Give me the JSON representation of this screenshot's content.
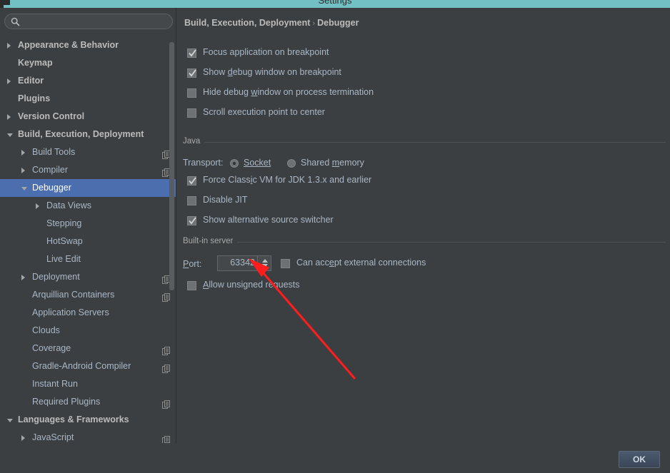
{
  "window": {
    "title": "Settings",
    "titlebar_color": "#72c0c4"
  },
  "sidebar": {
    "search": {
      "value": "",
      "placeholder": "",
      "icon": "search-icon"
    },
    "items": [
      {
        "label": "Appearance & Behavior",
        "indent": 0,
        "arrow": "closed",
        "bold": true,
        "scope_icon": false,
        "selected": false
      },
      {
        "label": "Keymap",
        "indent": 0,
        "arrow": "none",
        "bold": true,
        "scope_icon": false,
        "selected": false
      },
      {
        "label": "Editor",
        "indent": 0,
        "arrow": "closed",
        "bold": true,
        "scope_icon": false,
        "selected": false
      },
      {
        "label": "Plugins",
        "indent": 0,
        "arrow": "none",
        "bold": true,
        "scope_icon": false,
        "selected": false
      },
      {
        "label": "Version Control",
        "indent": 0,
        "arrow": "closed",
        "bold": true,
        "scope_icon": false,
        "selected": false
      },
      {
        "label": "Build, Execution, Deployment",
        "indent": 0,
        "arrow": "open",
        "bold": true,
        "scope_icon": false,
        "selected": false
      },
      {
        "label": "Build Tools",
        "indent": 1,
        "arrow": "closed",
        "bold": false,
        "scope_icon": true,
        "selected": false
      },
      {
        "label": "Compiler",
        "indent": 1,
        "arrow": "closed",
        "bold": false,
        "scope_icon": true,
        "selected": false
      },
      {
        "label": "Debugger",
        "indent": 1,
        "arrow": "open",
        "bold": false,
        "scope_icon": false,
        "selected": true
      },
      {
        "label": "Data Views",
        "indent": 2,
        "arrow": "closed",
        "bold": false,
        "scope_icon": false,
        "selected": false
      },
      {
        "label": "Stepping",
        "indent": 2,
        "arrow": "none",
        "bold": false,
        "scope_icon": false,
        "selected": false
      },
      {
        "label": "HotSwap",
        "indent": 2,
        "arrow": "none",
        "bold": false,
        "scope_icon": false,
        "selected": false
      },
      {
        "label": "Live Edit",
        "indent": 2,
        "arrow": "none",
        "bold": false,
        "scope_icon": false,
        "selected": false
      },
      {
        "label": "Deployment",
        "indent": 1,
        "arrow": "closed",
        "bold": false,
        "scope_icon": true,
        "selected": false
      },
      {
        "label": "Arquillian Containers",
        "indent": 1,
        "arrow": "none",
        "bold": false,
        "scope_icon": true,
        "selected": false
      },
      {
        "label": "Application Servers",
        "indent": 1,
        "arrow": "none",
        "bold": false,
        "scope_icon": false,
        "selected": false
      },
      {
        "label": "Clouds",
        "indent": 1,
        "arrow": "none",
        "bold": false,
        "scope_icon": false,
        "selected": false
      },
      {
        "label": "Coverage",
        "indent": 1,
        "arrow": "none",
        "bold": false,
        "scope_icon": true,
        "selected": false
      },
      {
        "label": "Gradle-Android Compiler",
        "indent": 1,
        "arrow": "none",
        "bold": false,
        "scope_icon": true,
        "selected": false
      },
      {
        "label": "Instant Run",
        "indent": 1,
        "arrow": "none",
        "bold": false,
        "scope_icon": false,
        "selected": false
      },
      {
        "label": "Required Plugins",
        "indent": 1,
        "arrow": "none",
        "bold": false,
        "scope_icon": true,
        "selected": false
      },
      {
        "label": "Languages & Frameworks",
        "indent": 0,
        "arrow": "open",
        "bold": true,
        "scope_icon": false,
        "selected": false
      },
      {
        "label": "JavaScript",
        "indent": 1,
        "arrow": "closed",
        "bold": false,
        "scope_icon": true,
        "selected": false
      }
    ],
    "selection_color": "#4b6eaf"
  },
  "panel": {
    "breadcrumb": {
      "parent": "Build, Execution, Deployment",
      "separator": "›",
      "current": "Debugger"
    },
    "top_options": [
      {
        "label": "Focus application on breakpoint",
        "checked": true,
        "mnemonic": ""
      },
      {
        "label": "Show debug window on breakpoint",
        "checked": true,
        "mnemonic": "d"
      },
      {
        "label": "Hide debug window on process termination",
        "checked": false,
        "mnemonic": "w"
      },
      {
        "label": "Scroll execution point to center",
        "checked": false,
        "mnemonic": ""
      }
    ],
    "java_group": {
      "title": "Java",
      "transport_label": "Transport:",
      "transport_options": [
        {
          "label": "Socket",
          "selected": true,
          "mnemonic": "S"
        },
        {
          "label": "Shared memory",
          "selected": false,
          "mnemonic": "m"
        }
      ],
      "options": [
        {
          "label": "Force Classic VM for JDK 1.3.x and earlier",
          "checked": true,
          "mnemonic": "i"
        },
        {
          "label": "Disable JIT",
          "checked": false,
          "mnemonic": ""
        },
        {
          "label": "Show alternative source switcher",
          "checked": true,
          "mnemonic": ""
        }
      ]
    },
    "server_group": {
      "title": "Built-in server",
      "port_label": "Port:",
      "port_value": "63342",
      "spinner_up_icon": "chevron-up-icon",
      "spinner_down_icon": "chevron-down-icon",
      "external_label": "Can accept external connections",
      "external_checked": false,
      "unsigned_label": "Allow unsigned requests",
      "unsigned_checked": false
    }
  },
  "footer": {
    "ok_label": "OK"
  },
  "annotation": {
    "arrow_color": "#ff1d1d",
    "points_to": "port-spinner"
  }
}
